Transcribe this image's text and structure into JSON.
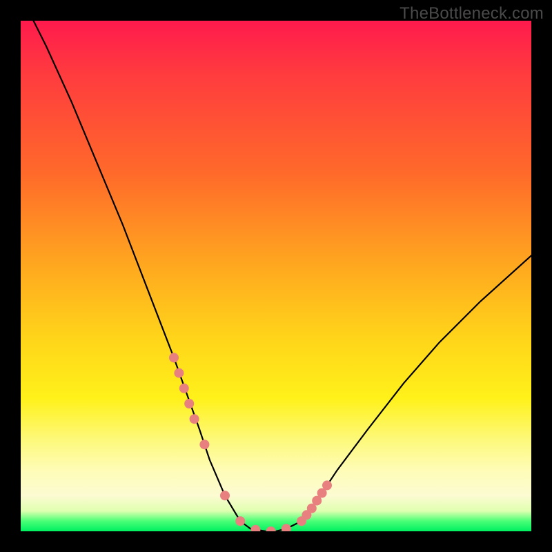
{
  "watermark": "TheBottleneck.com",
  "chart_data": {
    "type": "line",
    "title": "",
    "xlabel": "",
    "ylabel": "",
    "xlim": [
      0,
      100
    ],
    "ylim": [
      0,
      100
    ],
    "series": [
      {
        "name": "bottleneck-curve",
        "x": [
          0,
          5,
          10,
          15,
          20,
          25,
          30,
          35,
          37,
          40,
          43,
          45,
          48,
          50,
          52,
          55,
          58,
          62,
          68,
          75,
          82,
          90,
          100
        ],
        "values": [
          105,
          95,
          84,
          72,
          60,
          47,
          34,
          20,
          14,
          7,
          2,
          0.5,
          0,
          0,
          0.5,
          2,
          6,
          12,
          20,
          29,
          37,
          45,
          54
        ]
      }
    ],
    "markers": {
      "name": "data-points",
      "color": "#e98080",
      "radius_px": 7,
      "x": [
        30,
        31,
        32,
        33,
        34,
        36,
        40,
        43,
        46,
        49,
        52,
        55,
        56,
        57,
        58,
        59,
        60
      ],
      "values": [
        34,
        31,
        28,
        25,
        22,
        17,
        7,
        2,
        0.3,
        0,
        0.5,
        2,
        3.2,
        4.5,
        6,
        7.5,
        9
      ]
    },
    "gradient_stops": [
      {
        "pos": 0.0,
        "color": "#ff1a4d"
      },
      {
        "pos": 0.3,
        "color": "#ff6a2a"
      },
      {
        "pos": 0.62,
        "color": "#ffd41a"
      },
      {
        "pos": 0.88,
        "color": "#fefcb6"
      },
      {
        "pos": 0.98,
        "color": "#4aff77"
      },
      {
        "pos": 1.0,
        "color": "#00f060"
      }
    ]
  }
}
